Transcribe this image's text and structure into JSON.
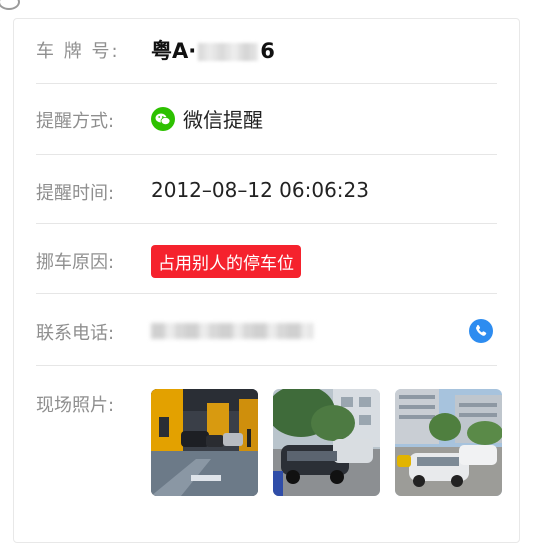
{
  "rows": {
    "plate": {
      "label": "车 牌 号:",
      "prefix": "粤A·",
      "suffix": "6"
    },
    "remind_method": {
      "label": "提醒方式:",
      "value": "微信提醒",
      "icon": "wechat-icon"
    },
    "remind_time": {
      "label": "提醒时间:",
      "value": "2012–08–12 06:06:23"
    },
    "reason": {
      "label": "挪车原因:",
      "value": "占用别人的停车位"
    },
    "phone": {
      "label": "联系电话:",
      "icon": "phone-icon"
    },
    "photos": {
      "label": "现场照片:",
      "count": 3
    }
  },
  "colors": {
    "badge_red": "#f5222d",
    "wechat_green": "#2dc100",
    "phone_blue": "#2d8cf0",
    "label_gray": "#8f8f8f"
  }
}
